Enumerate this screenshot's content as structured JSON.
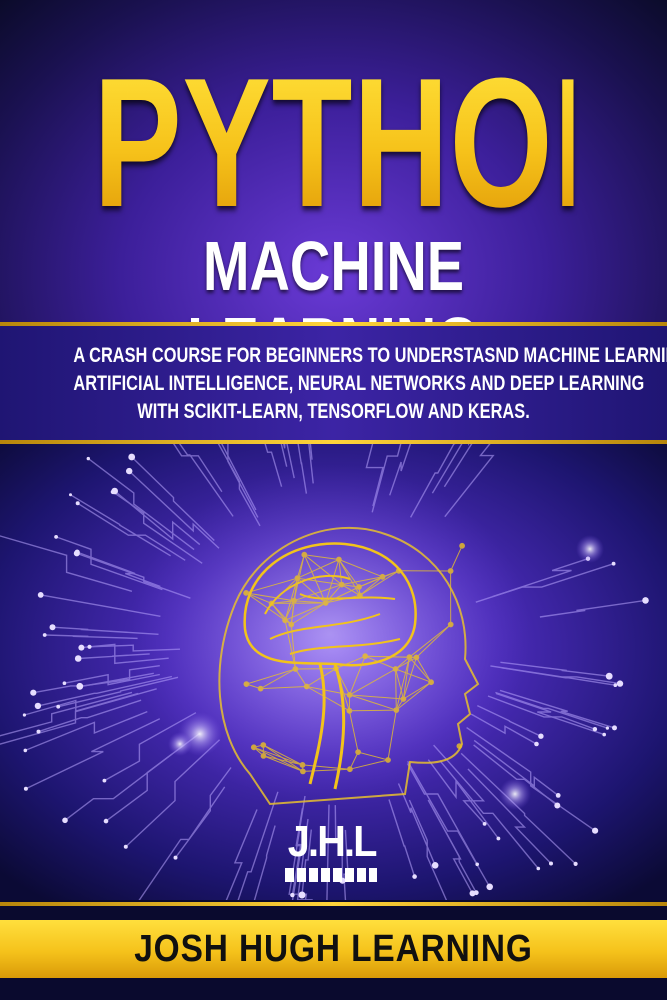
{
  "cover": {
    "title_main": "PYTHON",
    "title_sub": "MACHINE LEARNING",
    "tagline_lines": [
      "A CRASH COURSE FOR BEGINNERS TO UNDERSTASND  MACHINE LEARNING,",
      "ARTIFICIAL INTELLIGENCE, NEURAL NETWORKS AND DEEP LEARNING",
      "WITH SCIKIT-LEARN, TENSORFLOW AND KERAS."
    ],
    "publisher_logo": "J.H.L",
    "author": "JOSH HUGH LEARNING"
  },
  "colors": {
    "gold": "#f6c21a",
    "purple": "#3c24a5",
    "navy": "#0a0a2e",
    "white": "#ffffff"
  },
  "art": {
    "icons": [
      "circuit-board-background",
      "brain-head-network-illustration"
    ]
  }
}
